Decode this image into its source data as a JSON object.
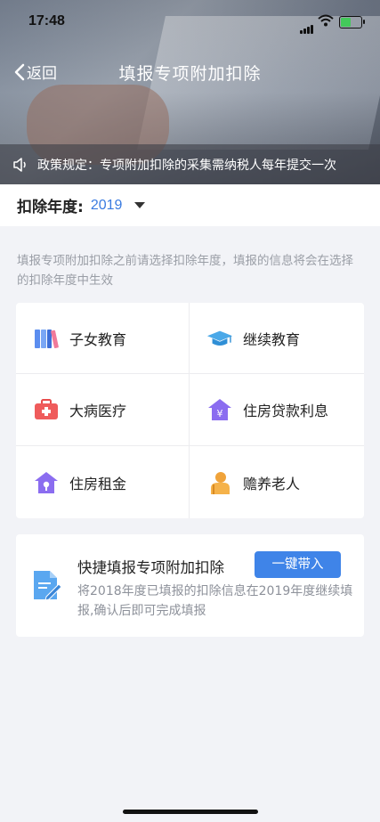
{
  "status_bar": {
    "time": "17:48"
  },
  "nav": {
    "back_label": "返回",
    "title": "填报专项附加扣除"
  },
  "notice": {
    "text": "政策规定：专项附加扣除的采集需纳税人每年提交一次"
  },
  "year": {
    "label": "扣除年度:",
    "value": "2019"
  },
  "hint": "填报专项附加扣除之前请选择扣除年度，填报的信息将会在选择的扣除年度中生效",
  "categories": [
    {
      "label": "子女教育",
      "icon": "books-icon"
    },
    {
      "label": "继续教育",
      "icon": "graduation-cap-icon"
    },
    {
      "label": "大病医疗",
      "icon": "medical-kit-icon"
    },
    {
      "label": "住房贷款利息",
      "icon": "house-yen-icon"
    },
    {
      "label": "住房租金",
      "icon": "house-key-icon"
    },
    {
      "label": "赡养老人",
      "icon": "elderly-icon"
    }
  ],
  "quick_fill": {
    "title": "快捷填报专项附加扣除",
    "button_label": "一键带入",
    "description": "将2018年度已填报的扣除信息在2019年度继续填报,确认后即可完成填报"
  },
  "colors": {
    "accent": "#3f84e8",
    "year_value": "#3a7be0"
  }
}
